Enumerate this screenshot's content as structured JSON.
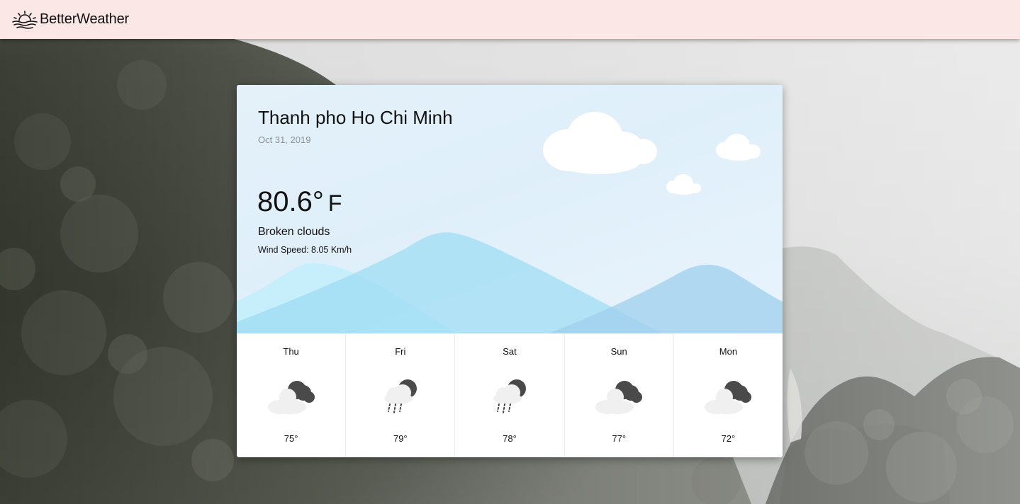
{
  "app": {
    "brand_name": "BetterWeather",
    "brand_icon": "sunset-over-water-icon"
  },
  "current": {
    "city": "Thanh pho Ho Chi Minh",
    "date": "Oct 31, 2019",
    "temperature": "80.6°",
    "unit": "F",
    "description": "Broken clouds",
    "wind": "Wind Speed: 8.05 Km/h"
  },
  "forecast": [
    {
      "day": "Thu",
      "temp": "75°",
      "icon": "cloudy-night-icon"
    },
    {
      "day": "Fri",
      "temp": "79°",
      "icon": "rainy-night-icon"
    },
    {
      "day": "Sat",
      "temp": "78°",
      "icon": "rainy-night-icon"
    },
    {
      "day": "Sun",
      "temp": "77°",
      "icon": "cloudy-night-icon"
    },
    {
      "day": "Mon",
      "temp": "72°",
      "icon": "cloudy-night-icon"
    }
  ],
  "colors": {
    "navbar_bg": "#fbe7e6",
    "card_sky": "#e4f1f9",
    "mountain_blue": "#aee1f5",
    "cloud_white": "#ffffff",
    "icon_dark": "#4a4a4a",
    "icon_cloud": "#f0f0f0"
  }
}
